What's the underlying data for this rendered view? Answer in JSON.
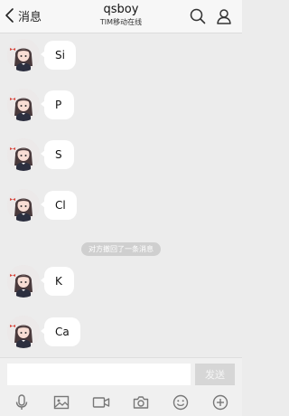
{
  "header": {
    "back_label": "消息",
    "title": "qsboy",
    "subtitle": "TIM移动在线"
  },
  "messages": [
    {
      "text": "Si"
    },
    {
      "text": "P"
    },
    {
      "text": "S"
    },
    {
      "text": "Cl"
    },
    {
      "text": "K"
    },
    {
      "text": "Ca"
    }
  ],
  "system_notice": "对方撤回了一条消息",
  "composer": {
    "input_value": "",
    "send_label": "发送"
  },
  "colors": {
    "chat_background": "#ececec",
    "bubble": "#ffffff",
    "send_disabled": "#d6d6d6"
  },
  "icons": {
    "header": [
      "search-icon",
      "contact-icon"
    ],
    "toolbar": [
      "microphone-icon",
      "image-icon",
      "video-icon",
      "camera-icon",
      "emoji-icon",
      "plus-icon"
    ]
  }
}
